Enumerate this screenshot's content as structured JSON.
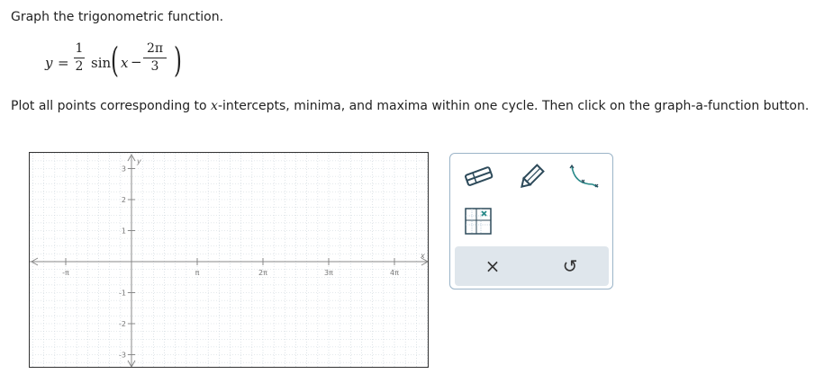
{
  "question": {
    "title": "Graph the trigonometric function.",
    "equation": {
      "lhs": "y",
      "equals": "=",
      "coef_num": "1",
      "coef_den": "2",
      "func": "sin",
      "var": "x",
      "minus": "−",
      "shift_num": "2π",
      "shift_den": "3"
    },
    "instruction_pre": "Plot all points corresponding to ",
    "instruction_var": "x",
    "instruction_post": "-intercepts, minima, and maxima within one cycle. Then click on the graph-a-function button."
  },
  "graph": {
    "x_axis_label": "x",
    "y_axis_label": "y",
    "x_ticks": [
      "-π",
      "π",
      "2π",
      "3π",
      "4π"
    ],
    "y_ticks": [
      "3",
      "2",
      "1",
      "-1",
      "-2",
      "-3"
    ]
  },
  "toolbox": {
    "tools": [
      "eraser-icon",
      "pencil-icon",
      "curve-icon",
      "plot-points-icon"
    ],
    "clear_label": "×",
    "undo_label": "↺"
  },
  "colors": {
    "accent": "#2a8a8a",
    "tool_outline": "#2d4a5a",
    "action_bar": "#dfe6ec",
    "toolbox_border": "#9bb4c8"
  }
}
